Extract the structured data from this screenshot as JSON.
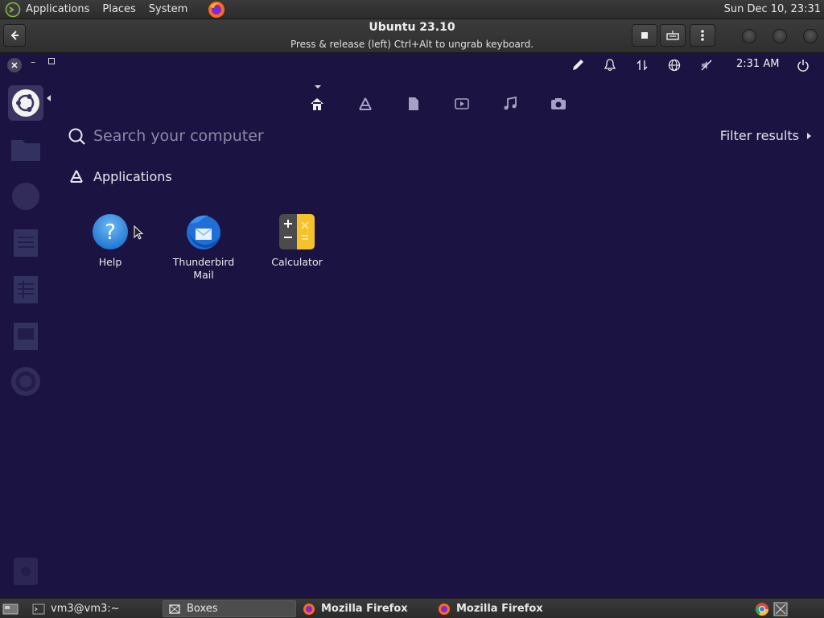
{
  "top_panel": {
    "menus": [
      "Applications",
      "Places",
      "System"
    ],
    "clock": "Sun Dec 10, 23:31"
  },
  "boxes_header": {
    "title": "Ubuntu 23.10",
    "subtitle": "Press & release (left) Ctrl+Alt to ungrab keyboard."
  },
  "guest": {
    "time": "2:31 AM",
    "search_placeholder": "Search your computer",
    "filter_label": "Filter results",
    "section_label": "Applications",
    "apps": [
      {
        "label": "Help",
        "icon": "help-icon"
      },
      {
        "label": "Thunderbird Mail",
        "icon": "thunderbird-icon"
      },
      {
        "label": "Calculator",
        "icon": "calculator-icon"
      }
    ],
    "lenses": [
      "home-icon",
      "applications-icon",
      "files-icon",
      "video-icon",
      "music-icon",
      "photo-icon"
    ]
  },
  "taskbar": {
    "items": [
      {
        "label": "vm3@vm3:~",
        "icon": "terminal-icon"
      },
      {
        "label": "Boxes",
        "icon": "boxes-icon"
      },
      {
        "label": "Mozilla Firefox",
        "icon": "firefox-icon"
      },
      {
        "label": "Mozilla Firefox",
        "icon": "firefox-icon"
      }
    ]
  },
  "colors": {
    "guest_bg": "#1b1442",
    "panel_bg": "#2f2f2f",
    "calculator_accent": "#f6c22b",
    "help_blue": "#2d8be0"
  }
}
